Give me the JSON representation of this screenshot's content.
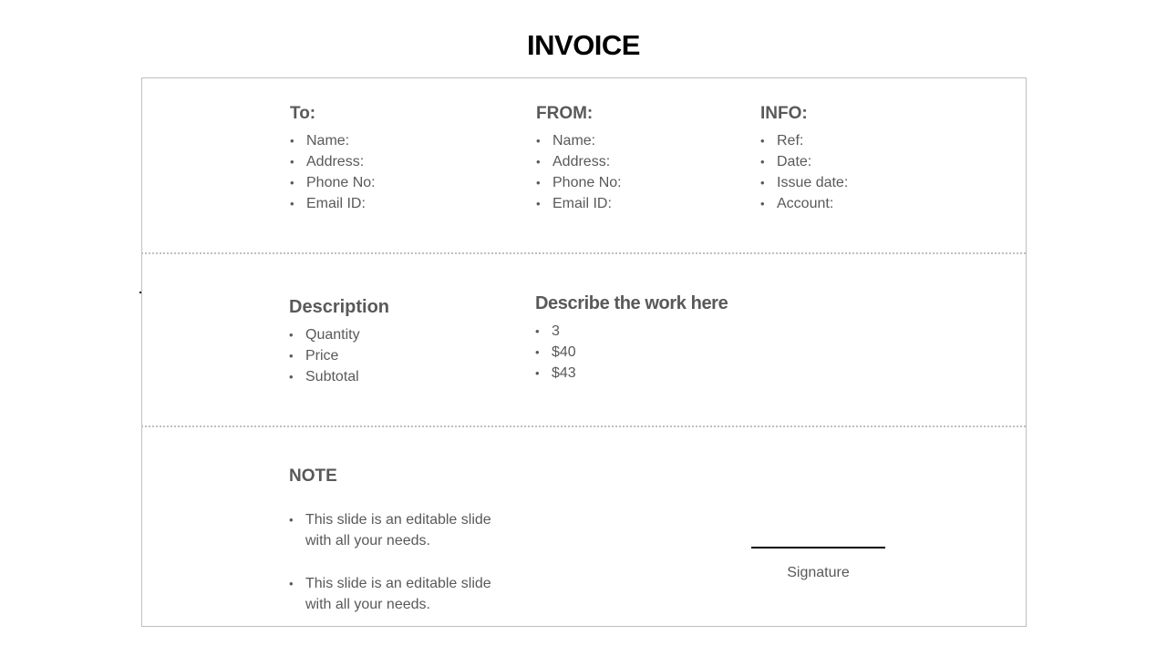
{
  "title": "INVOICE",
  "to": {
    "heading": "To:",
    "items": [
      "Name:",
      "Address:",
      "Phone No:",
      "Email ID:"
    ]
  },
  "from": {
    "heading": "FROM:",
    "items": [
      "Name:",
      "Address:",
      "Phone No:",
      "Email ID:"
    ]
  },
  "info": {
    "heading": "INFO:",
    "items": [
      "Ref:",
      "Date:",
      "Issue date:",
      "Account:"
    ]
  },
  "description": {
    "heading": "Description",
    "items": [
      "Quantity",
      "Price",
      "Subtotal"
    ]
  },
  "work": {
    "heading": "Describe the work here",
    "items": [
      "3",
      "$40",
      "$43"
    ]
  },
  "note": {
    "heading": "NOTE",
    "items": [
      "This slide is an editable slide with all your needs.",
      "This slide is an editable slide with all your needs."
    ]
  },
  "signature": {
    "label": "Signature"
  }
}
